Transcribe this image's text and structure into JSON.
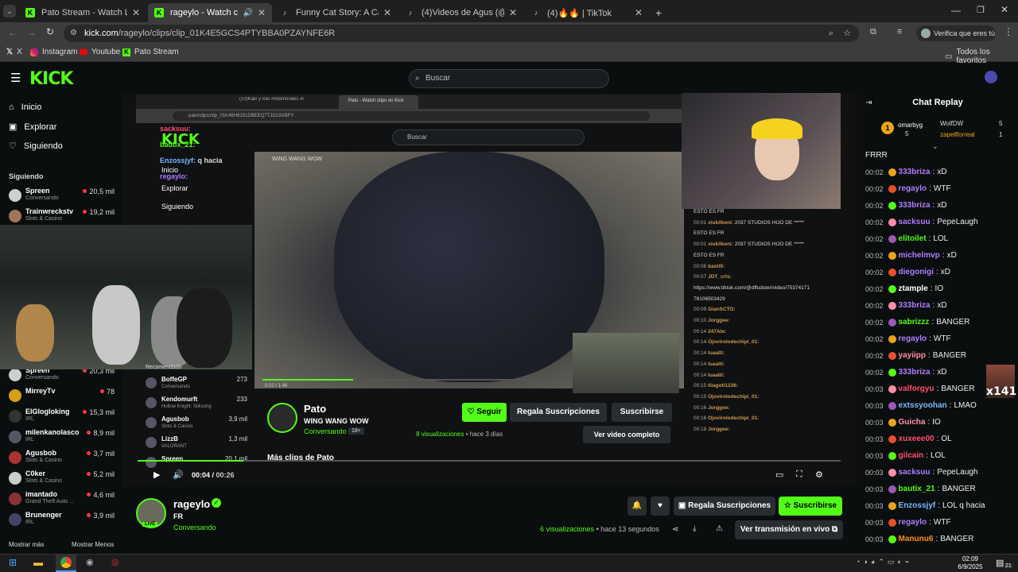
{
  "tabs": [
    {
      "title": "Pato Stream - Watch Live on Ki",
      "fav": "K",
      "favColor": "#53fc18"
    },
    {
      "title": "rageylo - Watch clips on Ki",
      "fav": "K",
      "favColor": "#53fc18"
    },
    {
      "title": "Funny Cat Story: A Cat's Love fo",
      "fav": "♪",
      "favColor": "#fff"
    },
    {
      "title": "(4)Videos de Agus (@agusester",
      "fav": "♪",
      "favColor": "#fff"
    },
    {
      "title": "(4)🔥🔥 | TikTok",
      "fav": "♪",
      "favColor": "#fff"
    }
  ],
  "new_tab": "+",
  "address": {
    "host": "kick.com",
    "path": "/rageylo/clips/clip_01K4E5GCS4PTYBBA0PZAYNFE6R"
  },
  "profile": "Verifica que eres tú",
  "bookmarks": [
    "X",
    "Instagram",
    "Youtube",
    "Pato Stream"
  ],
  "all_favorites": "Todos los favoritos",
  "kick": {
    "logo": "KICK",
    "search_placeholder": "Buscar"
  },
  "sidebar": {
    "nav": [
      "Inicio",
      "Explorar",
      "Siguiendo"
    ],
    "following_header": "Siguiendo",
    "top_users": [
      {
        "name": "Spreen",
        "game": "Conversando",
        "viewers": "20,5 mil",
        "color": "#cfcfcf"
      },
      {
        "name": "Trainwreckstv",
        "game": "Slots & Casino",
        "viewers": "19,2 mil",
        "color": "#a0765a"
      }
    ],
    "users": [
      {
        "name": "Spreen",
        "game": "Conversando",
        "viewers": "20,3 mil",
        "color": "#cfcfcf"
      },
      {
        "name": "MirreyTv",
        "game": "",
        "viewers": "78",
        "color": "#d4a014"
      },
      {
        "name": "ElGlogloking",
        "game": "IRL",
        "viewers": "15,3 mil",
        "color": "#333"
      },
      {
        "name": "milenkanolasco",
        "game": "IRL",
        "viewers": "8,9 mil",
        "color": "#556"
      },
      {
        "name": "Agusbob",
        "game": "Slots & Casino",
        "viewers": "3,7 mil",
        "color": "#a33"
      },
      {
        "name": "C0ker",
        "game": "Slots & Casino",
        "viewers": "5,2 mil",
        "color": "#ccc"
      },
      {
        "name": "imantado",
        "game": "Grand Theft Auto ...",
        "viewers": "4,6 mil",
        "color": "#833"
      },
      {
        "name": "Brunenger",
        "game": "IRL",
        "viewers": "3,9 mil",
        "color": "#446"
      }
    ],
    "show_more": "Mostrar más",
    "show_less": "Mostrar Menos"
  },
  "video": {
    "inner_tabs": [
      "(10)Kaki y Iolo #Iolomorales #i",
      "Pato - Watch clips on Kick"
    ],
    "inner_url": "pato/clips/clip_01K46H8151DBEEQ7TJG19XBFY",
    "inner_search": "Buscar",
    "inner_nav": [
      "Inicio",
      "Explorar",
      "Siguiendo"
    ],
    "clip_title": "WING WANG WOW",
    "recomendado": "Recomendado",
    "rec_users": [
      {
        "name": "BoffeGP",
        "game": "Conversando",
        "viewers": "273"
      },
      {
        "name": "Kendomurft",
        "game": "Hollow Knight: Silksong",
        "viewers": "233"
      },
      {
        "name": "Agusbob",
        "game": "Slots & Casino",
        "viewers": "3,9 mil"
      },
      {
        "name": "LizzB",
        "game": "VALORANT",
        "viewers": "1,3 mil"
      },
      {
        "name": "Spreen",
        "game": "",
        "viewers": "20,1 mil"
      }
    ],
    "overlay_chat": [
      {
        "user": "sacksuu:",
        "msg": ""
      },
      {
        "user": "bautix_21:",
        "msg": ""
      },
      {
        "user": "Enzossjyf:",
        "msg": "q hacia"
      },
      {
        "user": "regaylo:",
        "msg": ""
      }
    ],
    "inner_time": "0:22 / 1:46",
    "inner_channel": "Pato",
    "inner_title": "WING WANG WOW",
    "inner_category": "Conversando",
    "inner_age": "18+",
    "inner_follow": "Seguir",
    "inner_gift": "Regala Suscripciones",
    "inner_subscribe": "Suscribirse",
    "inner_views": "8 visualizaciones",
    "inner_ago": "• hace 3 días",
    "inner_full": "Ver video completo",
    "more_clips": "Más clips de Pato",
    "inner_chat": [
      {
        "t": "",
        "u": "",
        "m": "ESTO ES FR"
      },
      {
        "t": "00:01",
        "u": "xiukilkeni:",
        "m": "2037 STUDIOS HIJO DE *****"
      },
      {
        "t": "",
        "u": "",
        "m": "ESTO ES FR"
      },
      {
        "t": "00:01",
        "u": "xiukilkeni:",
        "m": "2037 STUDIOS HIJO DE *****"
      },
      {
        "t": "",
        "u": "",
        "m": "ESTO ES FR"
      },
      {
        "t": "00:06",
        "u": "basti9:",
        "m": ""
      },
      {
        "t": "00:07",
        "u": "JDT_crls:",
        "m": ""
      },
      {
        "t": "",
        "u": "",
        "m": "https://www.tiktok.com/@dffudster/video/75374171"
      },
      {
        "t": "",
        "u": "",
        "m": "76106503429"
      },
      {
        "t": "00:09",
        "u": "GianSCTO:",
        "m": ""
      },
      {
        "t": "00:10",
        "u": "Jorggee:",
        "m": ""
      },
      {
        "t": "00:14",
        "u": "247Ale:",
        "m": ""
      },
      {
        "t": "00:14",
        "u": "Ojovirolodechipi_01:",
        "m": ""
      },
      {
        "t": "00:14",
        "u": "luaalti:",
        "m": ""
      },
      {
        "t": "00:14",
        "u": "luaalti:",
        "m": ""
      },
      {
        "t": "00:14",
        "u": "luaalti:",
        "m": ""
      },
      {
        "t": "00:15",
        "u": "tiiagoti1236:",
        "m": ""
      },
      {
        "t": "00:15",
        "u": "Ojovirolodechipi_01:",
        "m": ""
      },
      {
        "t": "00:16",
        "u": "Jorggee:",
        "m": ""
      },
      {
        "t": "00:16",
        "u": "Ojovirolodechipi_01:",
        "m": ""
      },
      {
        "t": "00:18",
        "u": "Jorggee:",
        "m": ""
      }
    ],
    "time_current": "00:04",
    "time_total": "00:26"
  },
  "channel": {
    "name": "rageylo",
    "title": "FR",
    "category": "Conversando",
    "live": "LIVE",
    "gift": "Regala Suscripciones",
    "subscribe": "Suscribirse",
    "views": "6 visualizaciones",
    "ago": "• hace 13 segundos",
    "watch": "Ver transmisión en vivo"
  },
  "chat": {
    "title": "Chat Replay",
    "top_gifters": [
      {
        "name": "omarbyg",
        "count": "5"
      },
      {
        "name": "WolfDW",
        "count": "5"
      },
      {
        "name": "zapellforreal",
        "count": "1"
      }
    ],
    "first_line": "FRRR",
    "lines": [
      {
        "t": "00:02",
        "u": "333briza",
        "m": "xD",
        "c": "#b07cff"
      },
      {
        "t": "00:02",
        "u": "regaylo",
        "m": "WTF",
        "c": "#b07cff"
      },
      {
        "t": "00:02",
        "u": "333briza",
        "m": "xD",
        "c": "#b07cff"
      },
      {
        "t": "00:02",
        "u": "sacksuu",
        "m": "PepeLaugh",
        "c": "#b07cff"
      },
      {
        "t": "00:02",
        "u": "elitoilet",
        "m": "LOL",
        "c": "#53fc18"
      },
      {
        "t": "00:02",
        "u": "michelmvp",
        "m": "xD",
        "c": "#b07cff"
      },
      {
        "t": "00:02",
        "u": "diegonigi",
        "m": "xD",
        "c": "#b07cff"
      },
      {
        "t": "00:02",
        "u": "ztample",
        "m": "IO",
        "c": "#ffffff"
      },
      {
        "t": "00:02",
        "u": "333briza",
        "m": "xD",
        "c": "#b07cff"
      },
      {
        "t": "00:02",
        "u": "sabrizzz",
        "m": "BANGER",
        "c": "#53fc18"
      },
      {
        "t": "00:02",
        "u": "regaylo",
        "m": "WTF",
        "c": "#b07cff"
      },
      {
        "t": "00:02",
        "u": "yayiipp",
        "m": "BANGER",
        "c": "#ff8fa8"
      },
      {
        "t": "00:02",
        "u": "333briza",
        "m": "xD",
        "c": "#b07cff"
      },
      {
        "t": "00:03",
        "u": "valforgyu",
        "m": "BANGER",
        "c": "#ff4d6d"
      },
      {
        "t": "00:03",
        "u": "extssyoohan",
        "m": "LMAO",
        "c": "#7ab8ff"
      },
      {
        "t": "00:03",
        "u": "Guicha",
        "m": "IO",
        "c": "#ff8fa8"
      },
      {
        "t": "00:03",
        "u": "xuxeee00",
        "m": "OL",
        "c": "#ff4d6d"
      },
      {
        "t": "00:03",
        "u": "gilcain",
        "m": "LOL",
        "c": "#ff4d6d"
      },
      {
        "t": "00:03",
        "u": "sacksuu",
        "m": "PepeLaugh",
        "c": "#b07cff"
      },
      {
        "t": "00:03",
        "u": "bautix_21",
        "m": "BANGER",
        "c": "#53fc18"
      },
      {
        "t": "00:03",
        "u": "Enzossjyf",
        "m": "LOL q hacia",
        "c": "#7ab8ff"
      },
      {
        "t": "00:03",
        "u": "regaylo",
        "m": "WTF",
        "c": "#b07cff"
      },
      {
        "t": "00:03",
        "u": "Manunu6",
        "m": "BANGER",
        "c": "#ff8c1a"
      }
    ],
    "emote_label": "x141"
  },
  "taskbar": {
    "time": "02:09",
    "date": "6/9/2025",
    "notif": "21"
  }
}
